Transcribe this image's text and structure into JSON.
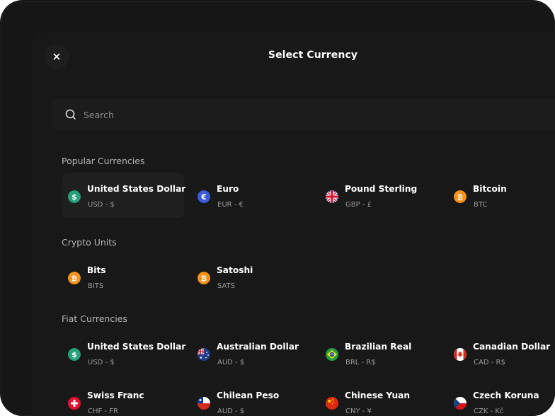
{
  "modal": {
    "title": "Select Currency"
  },
  "search": {
    "placeholder": "Search",
    "value": ""
  },
  "sections": {
    "popular": {
      "title": "Popular Currencies",
      "items": [
        {
          "name": "United States Dollar",
          "code": "USD - $",
          "icon": "dollar-icon"
        },
        {
          "name": "Euro",
          "code": "EUR - €",
          "icon": "euro-icon"
        },
        {
          "name": "Pound Sterling",
          "code": "GBP - £",
          "icon": "uk-flag-icon"
        },
        {
          "name": "Bitcoin",
          "code": "BTC",
          "icon": "bitcoin-icon"
        }
      ]
    },
    "crypto": {
      "title": "Crypto Units",
      "items": [
        {
          "name": "Bits",
          "code": "BITS",
          "icon": "bitcoin-icon"
        },
        {
          "name": "Satoshi",
          "code": "SATS",
          "icon": "bitcoin-icon"
        }
      ]
    },
    "fiat": {
      "title": "Fiat Currencies",
      "items": [
        {
          "name": "United States Dollar",
          "code": "USD - $",
          "icon": "dollar-icon"
        },
        {
          "name": "Australian Dollar",
          "code": "AUD - $",
          "icon": "australia-flag-icon"
        },
        {
          "name": "Brazilian Real",
          "code": "BRL - R$",
          "icon": "brazil-flag-icon"
        },
        {
          "name": "Canadian Dollar",
          "code": "CAD - R$",
          "icon": "canada-flag-icon"
        },
        {
          "name": "Swiss Franc",
          "code": "CHF - FR",
          "icon": "switzerland-flag-icon"
        },
        {
          "name": "Chilean Peso",
          "code": "AUD - $",
          "icon": "chile-flag-icon"
        },
        {
          "name": "Chinese Yuan",
          "code": "CNY - ¥",
          "icon": "china-flag-icon"
        },
        {
          "name": "Czech Koruna",
          "code": "CZK - Kč",
          "icon": "czech-flag-icon"
        }
      ]
    }
  },
  "colors": {
    "background": "#161616",
    "panel": "#181818",
    "dollar": "#26a17b",
    "euro": "#3b5bdb",
    "bitcoin": "#f7931a"
  }
}
